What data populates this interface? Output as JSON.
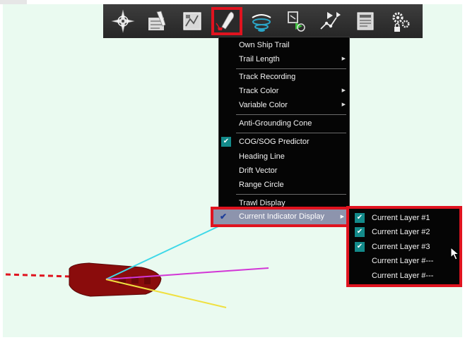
{
  "menu": {
    "items": [
      {
        "label": "Own Ship Trail"
      },
      {
        "label": "Trail Length",
        "submenu": true
      },
      {
        "label": "Track Recording"
      },
      {
        "label": "Track Color",
        "submenu": true
      },
      {
        "label": "Variable Color",
        "submenu": true
      },
      {
        "label": "Anti-Grounding Cone"
      },
      {
        "label": "COG/SOG Predictor",
        "checked": true
      },
      {
        "label": "Heading Line"
      },
      {
        "label": "Drift Vector"
      },
      {
        "label": "Range Circle"
      },
      {
        "label": "Trawl Display"
      }
    ],
    "highlighted": {
      "label": "Current Indicator Display",
      "checked": true,
      "submenu": true
    }
  },
  "submenu": {
    "items": [
      {
        "label": "Current Layer #1",
        "checked": true
      },
      {
        "label": "Current Layer #2",
        "checked": true
      },
      {
        "label": "Current Layer #3",
        "checked": true
      },
      {
        "label": "Current Layer #---",
        "checked": false
      },
      {
        "label": "Current Layer #---",
        "checked": false
      }
    ]
  },
  "toolbar": {
    "icons": [
      "compass-rose-icon",
      "chart-pen-icon",
      "chart-window-icon",
      "own-ship-icon",
      "sonar-icon",
      "target-icon",
      "route-icon",
      "document-icon",
      "settings-icon"
    ],
    "active": "own-ship-icon"
  },
  "colors": {
    "highlight_border": "#e0131f",
    "checkbox": "#138a8a",
    "ship_hull": "#8a0c0c",
    "vector_cyan": "#3ed8e8",
    "vector_magenta": "#d236d6",
    "vector_yellow": "#f0e040",
    "trail": "#e0131f"
  }
}
